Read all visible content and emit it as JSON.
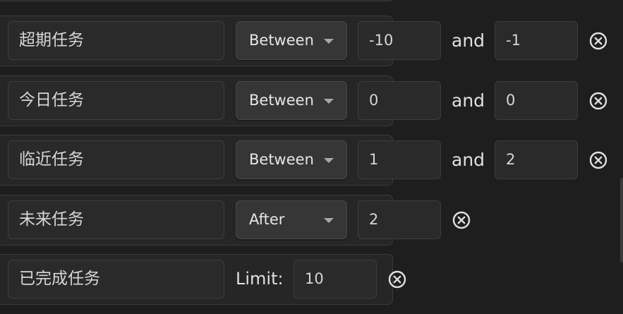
{
  "rows": [
    {
      "name": "超期任务",
      "operator": "Between",
      "from": "-10",
      "connector": "and",
      "to": "-1",
      "remove_icon": "close-circle-icon"
    },
    {
      "name": "今日任务",
      "operator": "Between",
      "from": "0",
      "connector": "and",
      "to": "0",
      "remove_icon": "close-circle-icon"
    },
    {
      "name": "临近任务",
      "operator": "Between",
      "from": "1",
      "connector": "and",
      "to": "2",
      "remove_icon": "close-circle-icon"
    },
    {
      "name": "未来任务",
      "operator": "After",
      "from": "2",
      "remove_icon": "close-circle-icon"
    },
    {
      "name": "已完成任务",
      "limit_label": "Limit:",
      "limit": "10",
      "remove_icon": "close-circle-icon"
    }
  ],
  "colors": {
    "background": "#1e1e1e",
    "row_background": "#262626",
    "field_background": "#2a2a2a",
    "select_background": "#363636",
    "text": "#d6d6d6",
    "icon": "#e0e0e0"
  }
}
